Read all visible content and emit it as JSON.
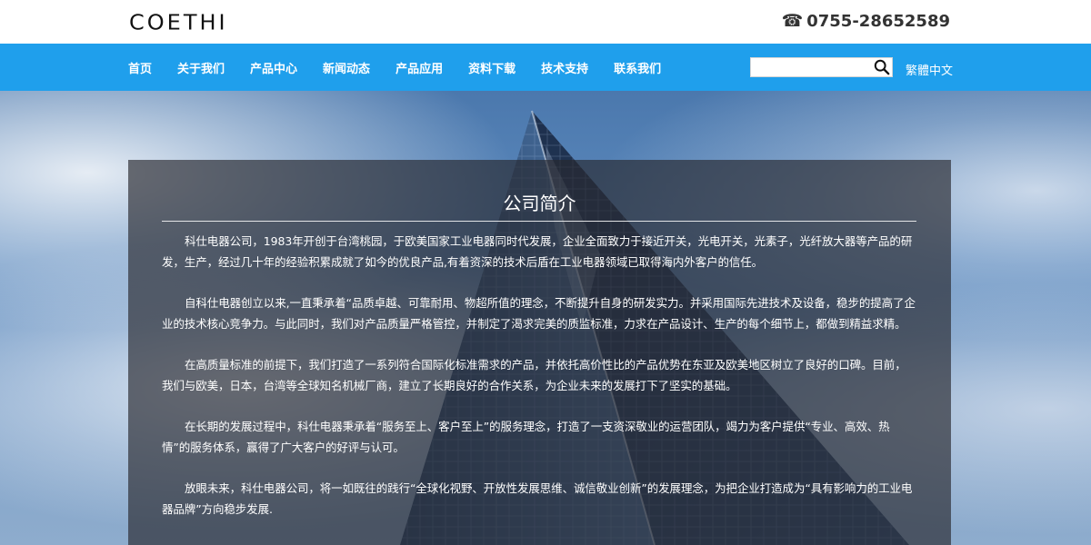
{
  "header": {
    "logo": "COETHI",
    "phone": "0755-28652589",
    "phone_icon": "phone-icon"
  },
  "nav": {
    "items": [
      "首页",
      "关于我们",
      "产品中心",
      "新闻动态",
      "产品应用",
      "资料下载",
      "技术支持",
      "联系我们"
    ],
    "search_placeholder": "",
    "search_icon": "search-icon",
    "lang_switch": "繁體中文"
  },
  "colors": {
    "nav_bg": "#1f9fec",
    "panel_bg": "rgba(40,40,45,0.66)",
    "text_light": "#ffffff"
  },
  "about": {
    "title": "公司简介",
    "paragraphs": [
      "科仕电器公司，1983年开创于台湾桃园，于欧美国家工业电器同时代发展，企业全面致力于接近开关，光电开关，光素子，光纤放大器等产品的研发，生产，经过几十年的经验积累成就了如今的优良产品,有着资深的技术后盾在工业电器领域已取得海内外客户的信任。",
      "自科仕电器创立以来,一直秉承着“品质卓越、可靠耐用、物超所值的理念，不断提升自身的研发实力。并采用国际先进技术及设备，稳步的提高了企业的技术核心竞争力。与此同时，我们对产品质量严格管控，并制定了渴求完美的质监标准，力求在产品设计、生产的每个细节上，都做到精益求精。",
      "在高质量标准的前提下，我们打造了一系列符合国际化标准需求的产品，并依托高价性比的产品优势在东亚及欧美地区树立了良好的口碑。目前，我们与欧美，日本，台湾等全球知名机械厂商，建立了长期良好的合作关系，为企业未来的发展打下了坚实的基础。",
      "在长期的发展过程中，科仕电器秉承着“服务至上、客户至上”的服务理念，打造了一支资深敬业的运营团队，竭力为客户提供“专业、高效、热情”的服务体系，赢得了广大客户的好评与认可。",
      "放眼未来，科仕电器公司，将一如既往的践行“全球化视野、开放性发展思维、诚信敬业创新”的发展理念，为把企业打造成为“具有影响力的工业电器品牌”方向稳步发展."
    ]
  }
}
